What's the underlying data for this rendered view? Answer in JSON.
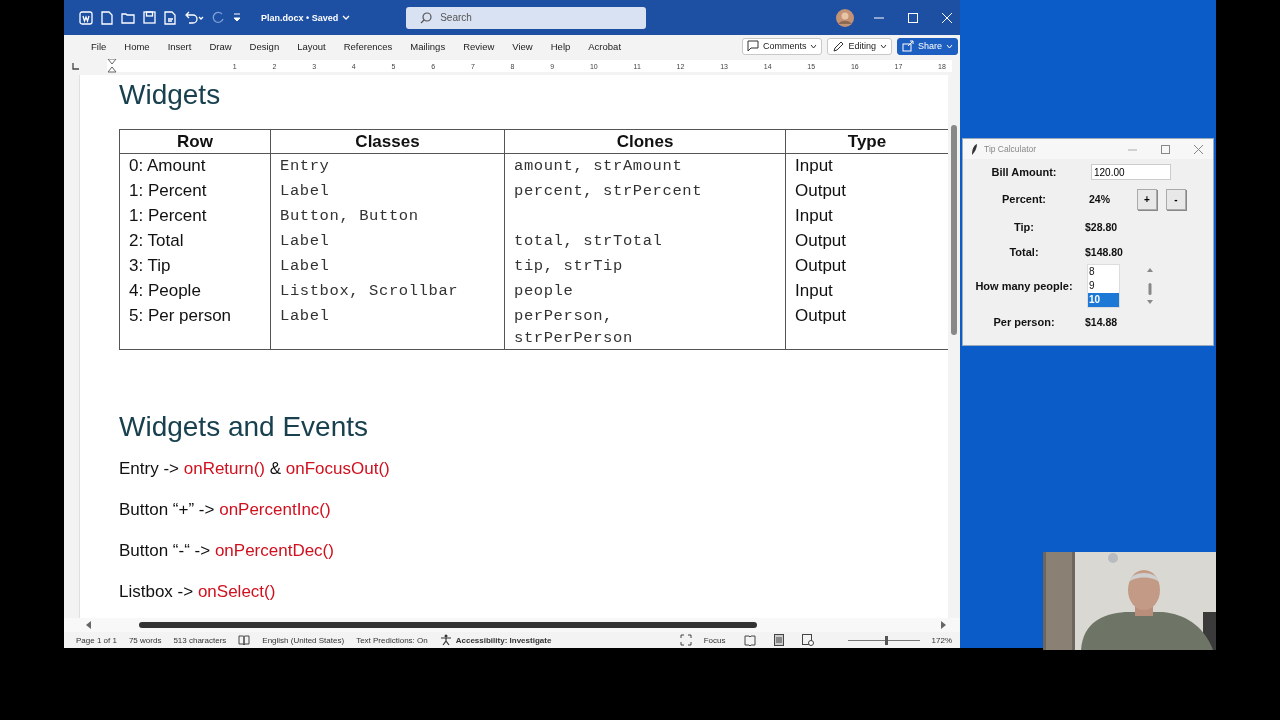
{
  "word": {
    "file_title": "Plan.docx • Saved",
    "search": {
      "placeholder": "Search"
    },
    "ribbon_tabs": [
      {
        "label": "File",
        "selected": false
      },
      {
        "label": "Home",
        "selected": false
      },
      {
        "label": "Insert",
        "selected": false
      },
      {
        "label": "Draw",
        "selected": false
      },
      {
        "label": "Design",
        "selected": false
      },
      {
        "label": "Layout",
        "selected": false
      },
      {
        "label": "References",
        "selected": false
      },
      {
        "label": "Mailings",
        "selected": false
      },
      {
        "label": "Review",
        "selected": false
      },
      {
        "label": "View",
        "selected": false
      },
      {
        "label": "Help",
        "selected": false
      },
      {
        "label": "Acrobat",
        "selected": false
      }
    ],
    "ribbon_buttons": [
      {
        "kind": "comments",
        "label": "Comments"
      },
      {
        "kind": "editing",
        "label": "Editing"
      },
      {
        "kind": "share",
        "label": "Share"
      }
    ],
    "ruler": [
      "1",
      "2",
      "3",
      "4",
      "5",
      "6",
      "7",
      "8",
      "9",
      "10",
      "11",
      "12",
      "13",
      "14",
      "15",
      "16",
      "17",
      "18"
    ],
    "document": {
      "heading_1": "Widgets",
      "table": {
        "columns": [
          "Row",
          "Classes",
          "Clones",
          "Type"
        ],
        "rows": [
          {
            "row": "0: Amount",
            "classes": "Entry",
            "clones": "amount, strAmount",
            "type": "Input"
          },
          {
            "row": "1: Percent",
            "classes": "Label",
            "clones": "percent, strPercent",
            "type": "Output"
          },
          {
            "row": "1: Percent",
            "classes": "Button, Button",
            "clones": "",
            "type": "Input"
          },
          {
            "row": "2: Total",
            "classes": "Label",
            "clones": "total, strTotal",
            "type": "Output"
          },
          {
            "row": "3: Tip",
            "classes": "Label",
            "clones": "tip, strTip",
            "type": "Output"
          },
          {
            "row": "4: People",
            "classes": "Listbox, Scrollbar",
            "clones": "people",
            "type": "Input"
          },
          {
            "row": "5: Per person",
            "classes": "Label",
            "clones": "perPerson, strPerPerson",
            "type": "Output"
          }
        ]
      },
      "heading_2": "Widgets and Events",
      "events": [
        [
          {
            "kind": "plain",
            "text": "Entry -> "
          },
          {
            "kind": "handler",
            "text": "onReturn()"
          },
          {
            "kind": "plain",
            "text": " & "
          },
          {
            "kind": "handler",
            "text": "onFocusOut()"
          }
        ],
        [
          {
            "kind": "plain",
            "text": "Button “+” -> "
          },
          {
            "kind": "handler",
            "text": "onPercentInc()"
          }
        ],
        [
          {
            "kind": "plain",
            "text": "Button “-“ -> "
          },
          {
            "kind": "handler",
            "text": "onPercentDec()"
          }
        ],
        [
          {
            "kind": "plain",
            "text": "Listbox -> "
          },
          {
            "kind": "handler",
            "text": "onSelect()"
          }
        ]
      ]
    },
    "status_bar": {
      "left": [
        "Page 1 of 1",
        "75 words",
        "513 characters"
      ],
      "language": "English (United States)",
      "predictions": "Text Predictions: On",
      "accessibility": "Accessibility: Investigate",
      "focus": "Focus",
      "zoom": {
        "level": 0.53,
        "reading": "172%"
      }
    }
  },
  "tip_calculator": {
    "title": "Tip Calculator",
    "bill_label": "Bill Amount:",
    "bill_value": "120.00",
    "percent_label": "Percent:",
    "percent_value": "24%",
    "buttons": [
      "+",
      "-"
    ],
    "tip_label": "Tip:",
    "tip_value": "$28.80",
    "total_label": "Total:",
    "total_value": "$148.80",
    "people_label": "How many people:",
    "people": [
      {
        "label": "8",
        "selected": false
      },
      {
        "label": "9",
        "selected": false
      },
      {
        "label": "10",
        "selected": true
      }
    ],
    "per_person_label": "Per person:",
    "per_person_value": "$14.88"
  }
}
